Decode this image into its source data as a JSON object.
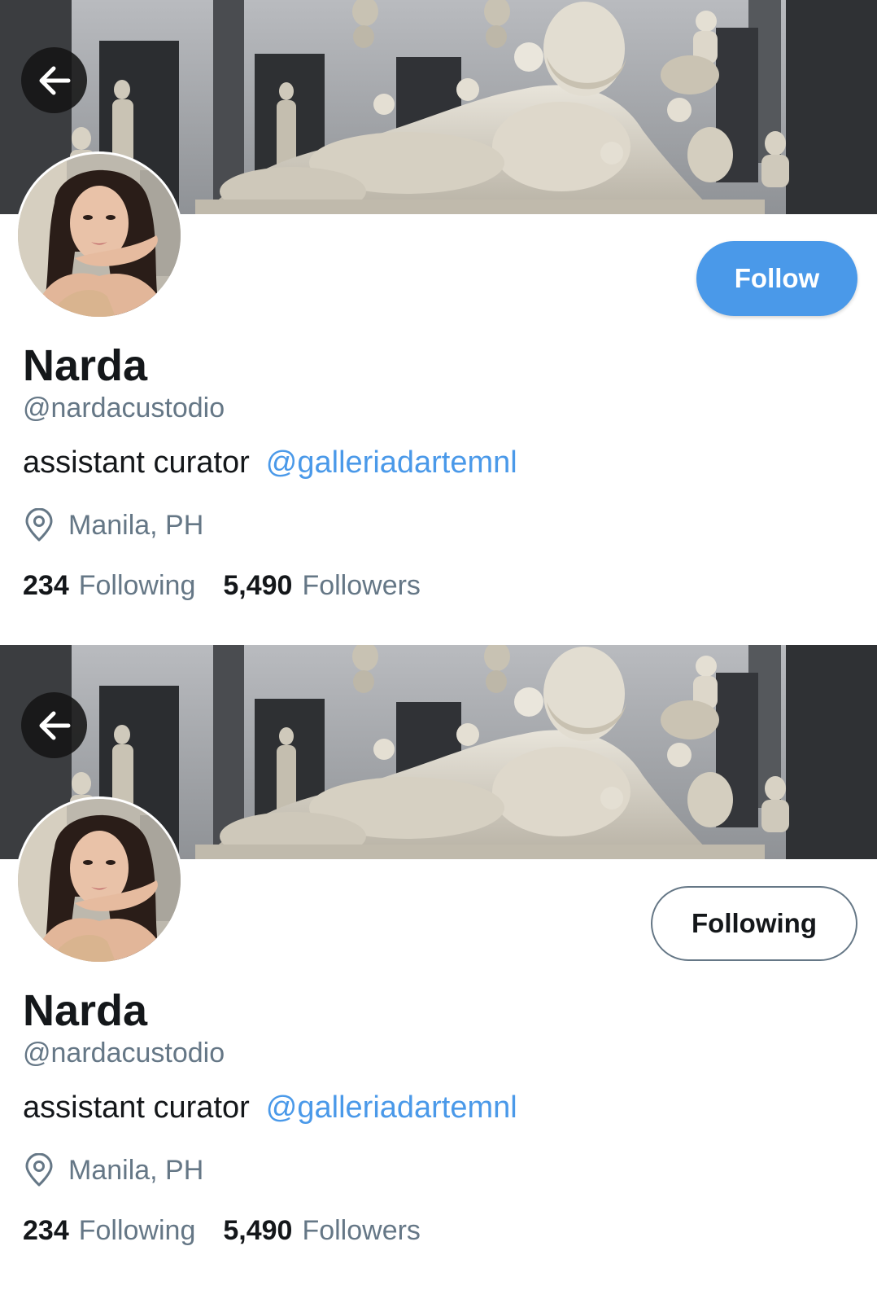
{
  "profiles": [
    {
      "follow_button": "Follow",
      "name": "Narda",
      "handle": "@nardacustodio",
      "bio_text": "assistant curator",
      "bio_mention": "@galleriadartemnl",
      "location": "Manila, PH",
      "following_count": "234",
      "following_label": "Following",
      "followers_count": "5,490",
      "followers_label": "Followers"
    },
    {
      "follow_button": "Following",
      "name": "Narda",
      "handle": "@nardacustodio",
      "bio_text": "assistant curator",
      "bio_mention": "@galleriadartemnl",
      "location": "Manila, PH",
      "following_count": "234",
      "following_label": "Following",
      "followers_count": "5,490",
      "followers_label": "Followers"
    }
  ],
  "icons": {
    "back": "arrow-left-icon",
    "location": "location-pin-icon"
  },
  "colors": {
    "accent": "#4a99e9",
    "primary_text": "#14171a",
    "secondary_text": "#657786",
    "button_border": "#657786"
  }
}
